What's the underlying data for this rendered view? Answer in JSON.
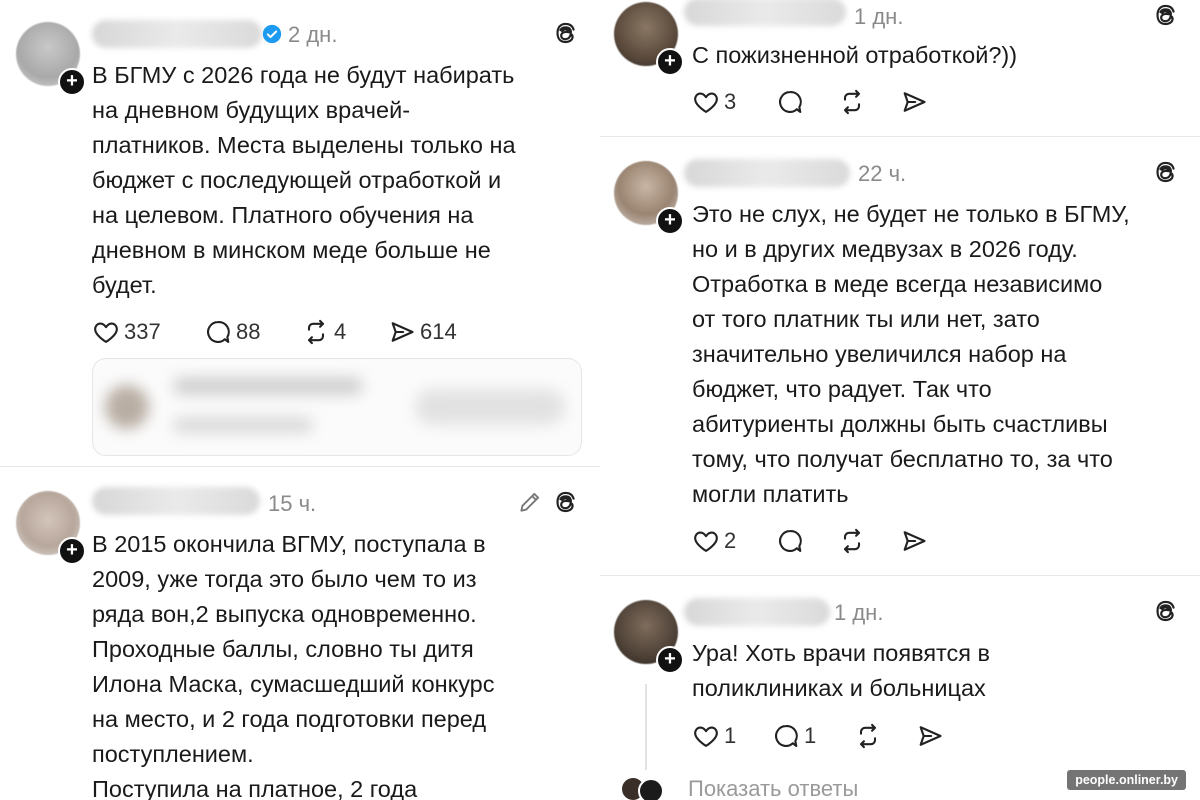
{
  "left_column": {
    "post1": {
      "time": "2 дн.",
      "verified": true,
      "lines": [
        "В БГМУ с 2026 года не будут набирать",
        "на дневном будущих врачей-",
        "платников. Места выделены только на",
        "бюджет с последующей отработкой и",
        "на целевом. Платного обучения на",
        "дневном в минском меде больше не",
        "будет."
      ],
      "likes": "337",
      "replies": "88",
      "reposts": "4",
      "shares": "614"
    },
    "post2": {
      "time": "15 ч.",
      "lines": [
        "В 2015 окончила ВГМУ, поступала в",
        "2009, уже тогда это было чем то из",
        "ряда вон,2 выпуска одновременно.",
        "Проходные баллы, словно ты дитя",
        "Илона Маска, сумасшедший конкурс",
        "на место, и 2 года подготовки перед",
        "поступлением.",
        "Поступила на платное, 2 года"
      ]
    }
  },
  "right_column": {
    "post1": {
      "time": "1 дн.",
      "lines": [
        "С пожизненной отработкой?))"
      ],
      "likes": "3"
    },
    "post2": {
      "time": "22 ч.",
      "lines": [
        "Это не слух, не будет не только в БГМУ,",
        "но и в других медвузах в 2026 году.",
        "Отработка в меде всегда независимо",
        "от того платник ты или нет, зато",
        "значительно увеличился набор на",
        "бюджет, что радует. Так что",
        "абитуриенты должны быть счастливы",
        "тому, что получат бесплатно то, за что",
        "могли платить"
      ],
      "likes": "2"
    },
    "post3": {
      "time": "1 дн.",
      "lines": [
        "Ура! Хоть врачи появятся в",
        "поликлиниках и больницах"
      ],
      "likes": "1",
      "replies": "1",
      "show_replies": "Показать ответы"
    }
  },
  "watermark": "people.onliner.by",
  "colors": {
    "verified": "#1d9bf0",
    "text": "#1a1a1a",
    "muted": "#8a8a8a"
  }
}
